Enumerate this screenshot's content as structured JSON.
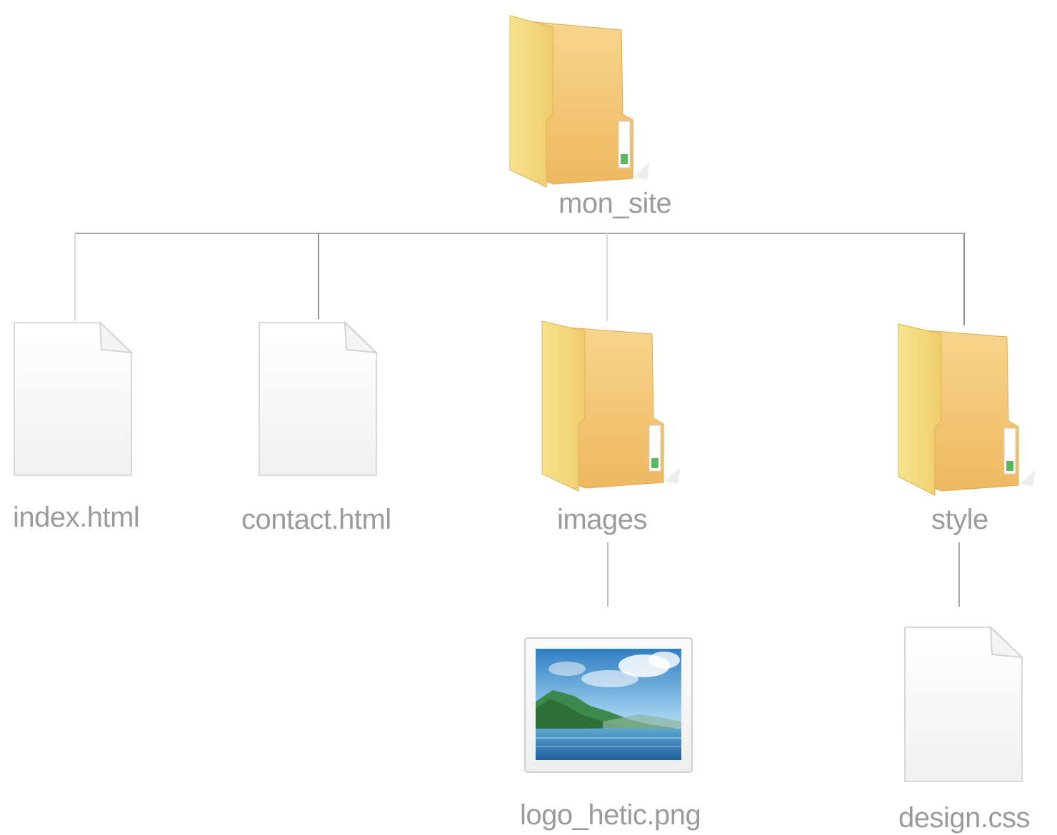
{
  "tree": {
    "root": {
      "name": "mon_site",
      "icon": "folder-icon"
    },
    "children": [
      {
        "name": "index.html",
        "icon": "document-file-icon"
      },
      {
        "name": "contact.html",
        "icon": "document-file-icon"
      },
      {
        "name": "images",
        "icon": "folder-icon",
        "children": [
          {
            "name": "logo_hetic.png",
            "icon": "image-file-icon"
          }
        ]
      },
      {
        "name": "style",
        "icon": "folder-icon",
        "children": [
          {
            "name": "design.css",
            "icon": "document-file-icon"
          }
        ]
      }
    ]
  },
  "colors": {
    "connector": "#a9a9a9",
    "label": "#9b9b9b",
    "folder_back": "#f2c46d",
    "folder_front": "#f5dc84",
    "folder_tab_indicator": "#5cb85c",
    "document": "#fafafa"
  }
}
